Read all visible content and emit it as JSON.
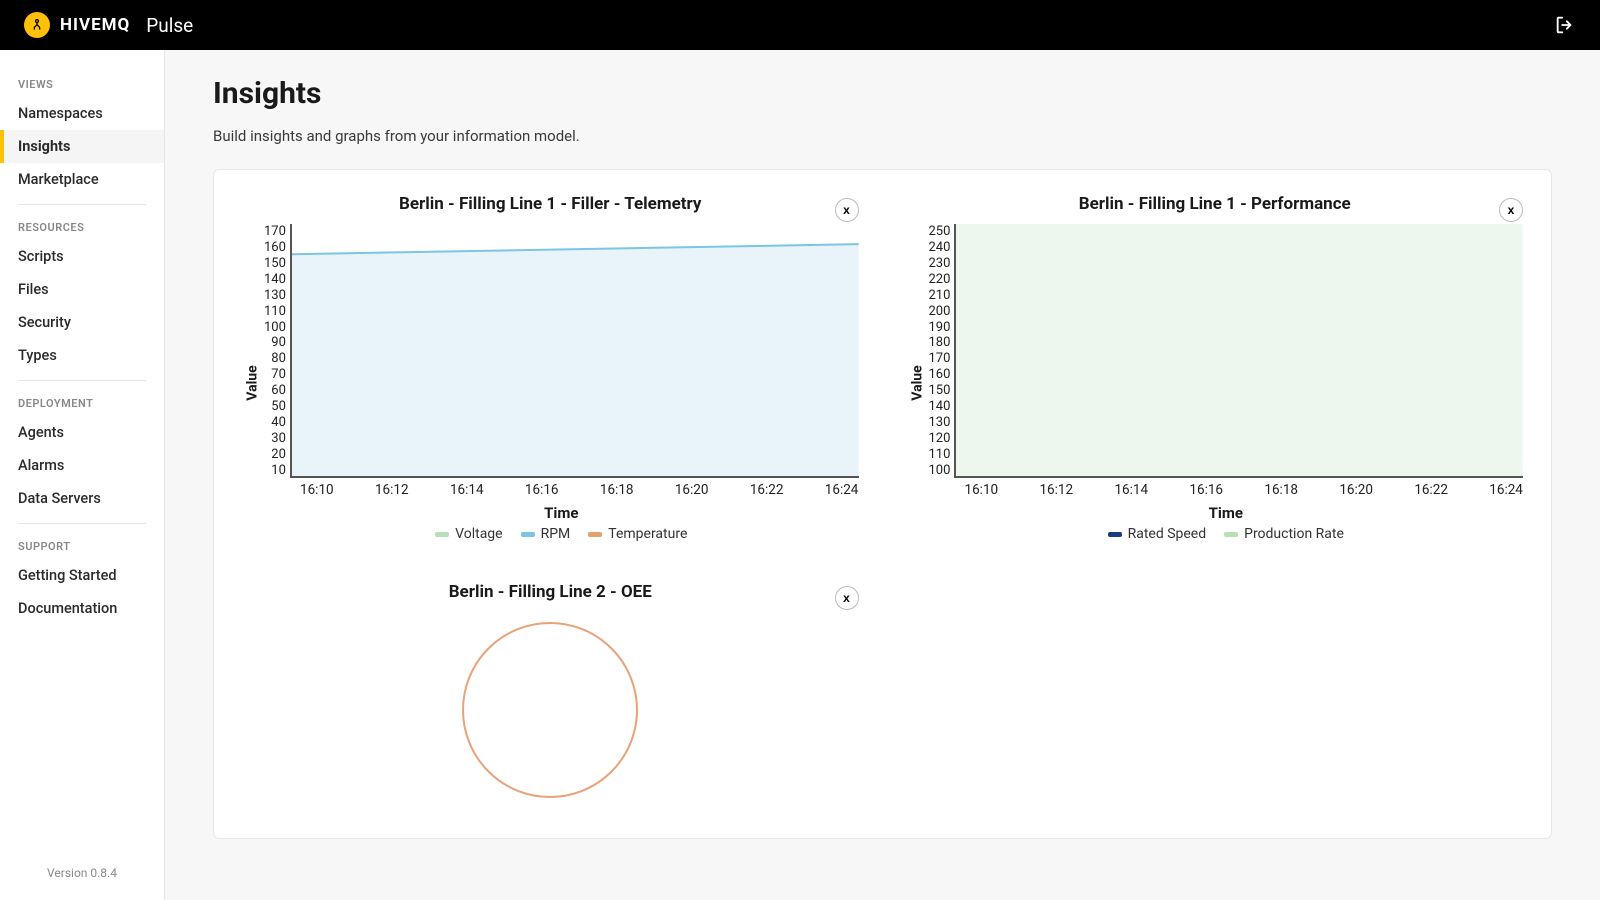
{
  "brand": {
    "name": "HIVEMQ",
    "product": "Pulse"
  },
  "sidebar": {
    "sections": [
      {
        "label": "VIEWS",
        "items": [
          "Namespaces",
          "Insights",
          "Marketplace"
        ],
        "active_index": 1
      },
      {
        "label": "RESOURCES",
        "items": [
          "Scripts",
          "Files",
          "Security",
          "Types"
        ]
      },
      {
        "label": "DEPLOYMENT",
        "items": [
          "Agents",
          "Alarms",
          "Data Servers"
        ]
      },
      {
        "label": "SUPPORT",
        "items": [
          "Getting Started",
          "Documentation"
        ]
      }
    ],
    "version": "Version 0.8.4"
  },
  "page": {
    "title": "Insights",
    "subtitle": "Build insights and graphs from your information model."
  },
  "charts": [
    {
      "title": "Berlin - Filling Line 1 - Filler - Telemetry",
      "close_label": "x",
      "xlabel": "Time",
      "ylabel": "Value",
      "yticks": [
        "170",
        "160",
        "150",
        "140",
        "130",
        "110",
        "100",
        "90",
        "80",
        "70",
        "60",
        "50",
        "40",
        "30",
        "20",
        "10"
      ],
      "xticks": [
        "16:10",
        "16:12",
        "16:14",
        "16:16",
        "16:18",
        "16:20",
        "16:22",
        "16:24"
      ],
      "legend": [
        {
          "label": "Voltage",
          "color": "#b7e1b5"
        },
        {
          "label": "RPM",
          "color": "#7cc5e3"
        },
        {
          "label": "Temperature",
          "color": "#e6a06a"
        }
      ],
      "area_fill": "#e9f4fa",
      "line_color": "#7cc5e3"
    },
    {
      "title": "Berlin - Filling Line 1 - Performance",
      "close_label": "x",
      "xlabel": "Time",
      "ylabel": "Value",
      "yticks": [
        "250",
        "240",
        "230",
        "220",
        "210",
        "200",
        "190",
        "180",
        "170",
        "160",
        "150",
        "140",
        "130",
        "120",
        "110",
        "100"
      ],
      "xticks": [
        "16:10",
        "16:12",
        "16:14",
        "16:16",
        "16:18",
        "16:20",
        "16:22",
        "16:24"
      ],
      "legend": [
        {
          "label": "Rated Speed",
          "color": "#1b3a8a"
        },
        {
          "label": "Production Rate",
          "color": "#b7e1b5"
        }
      ],
      "area_fill": "#eef7ee",
      "line_color": "none"
    },
    {
      "title": "Berlin - Filling Line 2 - OEE",
      "close_label": "x",
      "pie_color": "#eaa27b"
    }
  ],
  "chart_data": [
    {
      "type": "line",
      "title": "Berlin - Filling Line 1 - Filler - Telemetry",
      "xlabel": "Time",
      "ylabel": "Value",
      "x": [
        "16:10",
        "16:12",
        "16:14",
        "16:16",
        "16:18",
        "16:20",
        "16:22",
        "16:24"
      ],
      "ylim": [
        10,
        170
      ],
      "series": [
        {
          "name": "Voltage",
          "values": [
            null,
            null,
            null,
            null,
            null,
            null,
            null,
            null
          ]
        },
        {
          "name": "RPM",
          "values": [
            150,
            151,
            152,
            153,
            154,
            155,
            156,
            157
          ]
        },
        {
          "name": "Temperature",
          "values": [
            null,
            null,
            null,
            null,
            null,
            null,
            null,
            null
          ]
        }
      ],
      "legend_position": "bottom",
      "grid": false
    },
    {
      "type": "area",
      "title": "Berlin - Filling Line 1 - Performance",
      "xlabel": "Time",
      "ylabel": "Value",
      "x": [
        "16:10",
        "16:12",
        "16:14",
        "16:16",
        "16:18",
        "16:20",
        "16:22",
        "16:24"
      ],
      "ylim": [
        100,
        250
      ],
      "series": [
        {
          "name": "Rated Speed",
          "values": [
            null,
            null,
            null,
            null,
            null,
            null,
            null,
            null
          ]
        },
        {
          "name": "Production Rate",
          "values": [
            250,
            250,
            250,
            250,
            250,
            250,
            250,
            250
          ]
        }
      ],
      "legend_position": "bottom",
      "grid": false
    },
    {
      "type": "pie",
      "title": "Berlin - Filling Line 2 - OEE",
      "series": [
        {
          "name": "OEE",
          "value": 100
        }
      ]
    }
  ]
}
